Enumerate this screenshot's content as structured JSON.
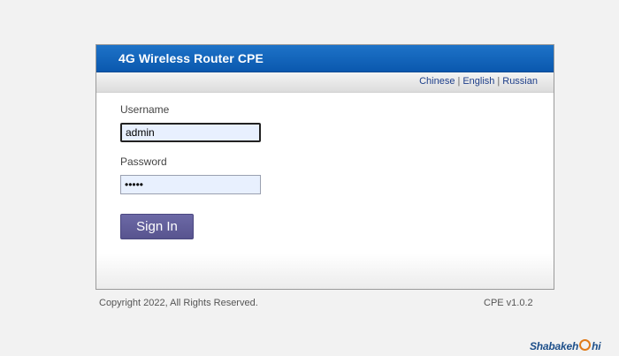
{
  "header": {
    "title": "4G Wireless Router CPE"
  },
  "languages": {
    "items": [
      "Chinese",
      "English",
      "Russian"
    ],
    "separator": "|"
  },
  "form": {
    "username_label": "Username",
    "username_value": "admin",
    "password_label": "Password",
    "password_value": "•••••",
    "signin_label": "Sign In"
  },
  "footer": {
    "copyright": "Copyright 2022, All Rights Reserved.",
    "version": "CPE v1.0.2"
  },
  "watermark": {
    "text_before": "Shabakeh",
    "text_after": "hi"
  },
  "colors": {
    "header_blue": "#0a58ae",
    "button_purple": "#5f5b99",
    "input_bg": "#e8f0fe",
    "link_blue": "#1e3f8a",
    "watermark_orange": "#e07b1a"
  }
}
